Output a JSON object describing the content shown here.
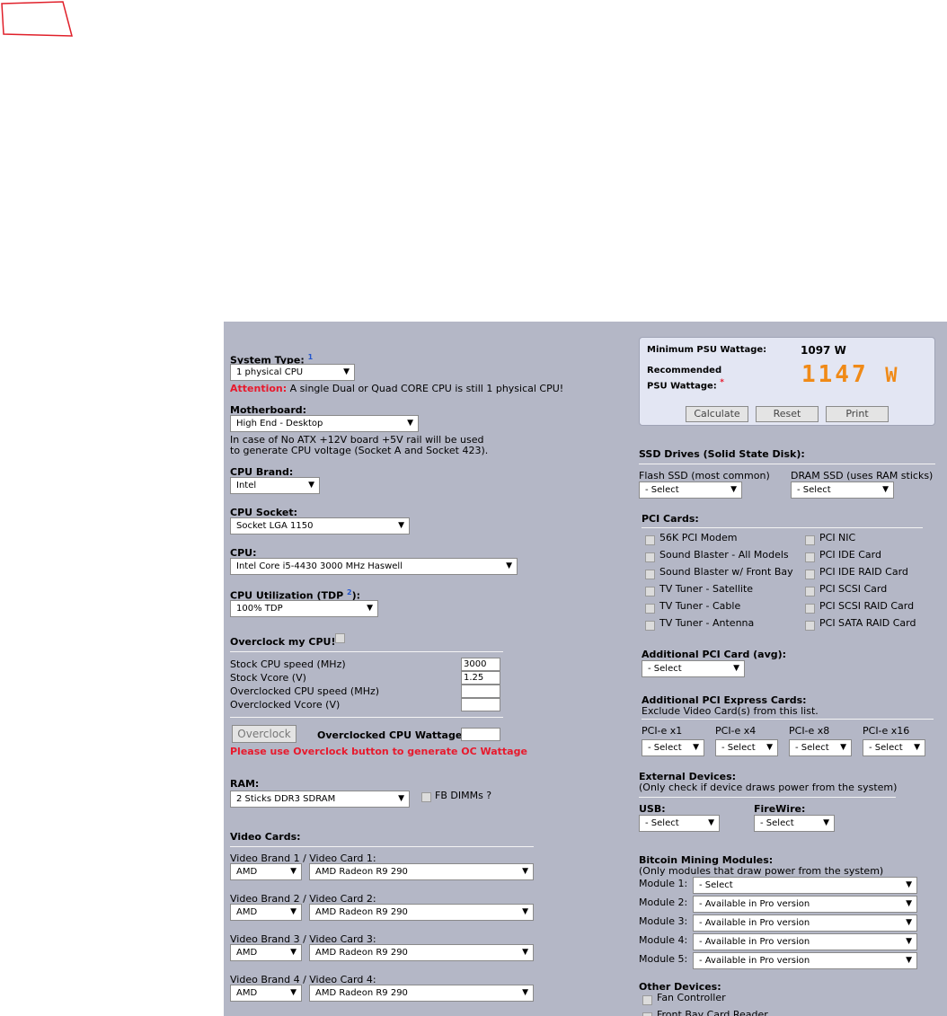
{
  "psu": {
    "min_label": "Minimum PSU Wattage:",
    "min_value": "1097 W",
    "rec_label_1": "Recommended",
    "rec_label_2": "PSU Wattage:",
    "rec_star": "*",
    "rec_value": "1147",
    "rec_unit": "W",
    "calculate": "Calculate",
    "reset": "Reset",
    "print": "Print"
  },
  "left": {
    "system_type_label": "System Type:",
    "system_type_sup": "1",
    "system_type_value": "1 physical CPU",
    "attention_label": "Attention:",
    "attention_text": " A single Dual or Quad CORE CPU is still 1 physical CPU!",
    "motherboard_label": "Motherboard:",
    "motherboard_value": "High End - Desktop",
    "motherboard_note_1": "In case of No ATX +12V board +5V rail will be used",
    "motherboard_note_2": "to generate CPU voltage (Socket A and Socket 423).",
    "cpu_brand_label": "CPU Brand:",
    "cpu_brand_value": "Intel",
    "cpu_socket_label": "CPU Socket:",
    "cpu_socket_value": "Socket LGA 1150",
    "cpu_label": "CPU:",
    "cpu_value": "Intel Core i5-4430 3000 MHz Haswell",
    "cpu_util_label": "CPU Utilization (TDP",
    "cpu_util_sup": "2",
    "cpu_util_suffix": "):",
    "cpu_util_value": "100% TDP",
    "overclock_label": "Overclock my CPU!",
    "stock_speed_label": "Stock CPU speed (MHz)",
    "stock_speed_value": "3000",
    "stock_vcore_label": "Stock Vcore (V)",
    "stock_vcore_value": "1.25",
    "oc_speed_label": "Overclocked CPU speed (MHz)",
    "oc_vcore_label": "Overclocked Vcore (V)",
    "overclock_button": "Overclock",
    "oc_wattage_label": "Overclocked CPU Wattage:",
    "oc_warning": "Please use Overclock button to generate OC Wattage",
    "ram_label": "RAM:",
    "ram_value": "2 Sticks DDR3 SDRAM",
    "fb_dimms_label": "FB DIMMs ?",
    "video_cards_label": "Video Cards:",
    "video_rows": [
      {
        "label": "Video Brand 1 / Video Card 1:",
        "brand": "AMD",
        "card": "AMD Radeon R9 290"
      },
      {
        "label": "Video Brand 2 / Video Card 2:",
        "brand": "AMD",
        "card": "AMD Radeon R9 290"
      },
      {
        "label": "Video Brand 3 / Video Card 3:",
        "brand": "AMD",
        "card": "AMD Radeon R9 290"
      },
      {
        "label": "Video Brand 4 / Video Card 4:",
        "brand": "AMD",
        "card": "AMD Radeon R9 290"
      }
    ]
  },
  "right": {
    "ssd_label": "SSD Drives (Solid State Disk):",
    "flash_ssd_label": "Flash SSD (most common)",
    "flash_ssd_value": "- Select",
    "dram_ssd_label": "DRAM SSD (uses RAM sticks)",
    "dram_ssd_value": "- Select",
    "pci_cards_label": "PCI Cards:",
    "pci_left": [
      "56K PCI Modem",
      "Sound Blaster - All Models",
      "Sound Blaster w/ Front Bay",
      "TV Tuner - Satellite",
      "TV Tuner - Cable",
      "TV Tuner - Antenna"
    ],
    "pci_right": [
      "PCI NIC",
      "PCI IDE Card",
      "PCI IDE RAID Card",
      "PCI SCSI Card",
      "PCI SCSI RAID Card",
      "PCI SATA RAID Card"
    ],
    "add_pci_label": "Additional PCI Card (avg):",
    "add_pci_value": "- Select",
    "pcie_label": "Additional PCI Express Cards:",
    "pcie_note": "Exclude Video Card(s) from this list.",
    "pcie_slots": [
      {
        "label": "PCI-e x1",
        "value": "- Select"
      },
      {
        "label": "PCI-e x4",
        "value": "- Select"
      },
      {
        "label": "PCI-e x8",
        "value": "- Select"
      },
      {
        "label": "PCI-e x16",
        "value": "- Select"
      }
    ],
    "ext_label": "External Devices:",
    "ext_note": "(Only check if device draws power from the system)",
    "usb_label": "USB:",
    "usb_value": "- Select",
    "firewire_label": "FireWire:",
    "firewire_value": "- Select",
    "btc_label": "Bitcoin Mining Modules:",
    "btc_note": "(Only modules that draw power from the system)",
    "modules": [
      {
        "label": "Module 1:",
        "value": "- Select"
      },
      {
        "label": "Module 2:",
        "value": "- Available in Pro version"
      },
      {
        "label": "Module 3:",
        "value": "- Available in Pro version"
      },
      {
        "label": "Module 4:",
        "value": "- Available in Pro version"
      },
      {
        "label": "Module 5:",
        "value": "- Available in Pro version"
      }
    ],
    "other_label": "Other Devices:",
    "other_items": [
      "Fan Controller",
      "Front Bay Card Reader"
    ]
  }
}
